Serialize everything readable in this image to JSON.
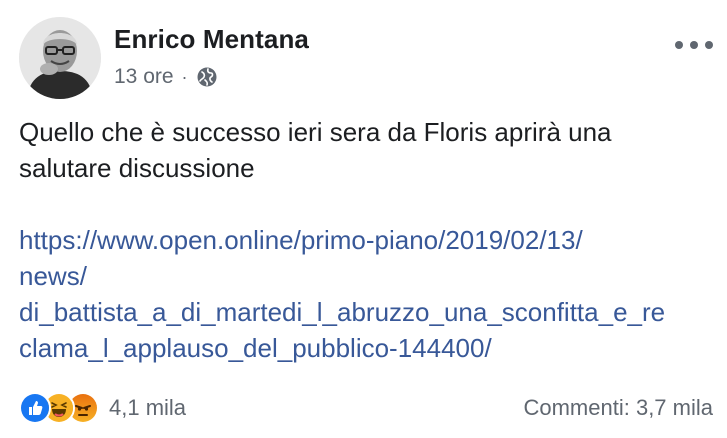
{
  "post": {
    "author": "Enrico Mentana",
    "time": "13 ore",
    "separator": "·",
    "privacy_icon": "globe-icon",
    "more_icon": "more-options-icon",
    "text_lines": [
      "Quello che è successo ieri sera da Floris aprirà una",
      "salutare discussione"
    ],
    "link_lines": [
      "https://www.open.online/primo-piano/2019/02/13/",
      "news/",
      "di_battista_a_di_martedi_l_abruzzo_una_sconfitta_e_re",
      "clama_l_applauso_del_pubblico-144400/"
    ]
  },
  "footer": {
    "reaction_icons": [
      "like-icon",
      "haha-icon",
      "angry-icon"
    ],
    "reaction_count": "4,1 mila",
    "comments": "Commenti: 3,7 mila"
  },
  "colors": {
    "link": "#385898",
    "secondary_text": "#606770",
    "primary_text": "#1c1e21",
    "like_blue": "#1877f2",
    "haha_yellow": "#f7b125",
    "angry_orange": "#e9710f"
  }
}
